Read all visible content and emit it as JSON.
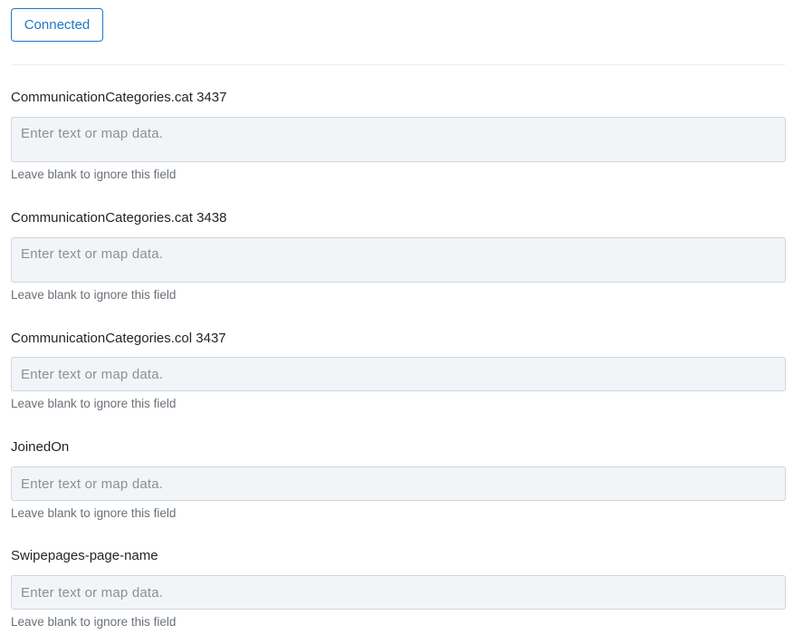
{
  "header": {
    "connected_label": "Connected"
  },
  "fields": [
    {
      "label": "CommunicationCategories.cat 3437",
      "value": "",
      "placeholder": "Enter text or map data.",
      "help": "Leave blank to ignore this field"
    },
    {
      "label": "CommunicationCategories.cat 3438",
      "value": "",
      "placeholder": "Enter text or map data.",
      "help": "Leave blank to ignore this field"
    },
    {
      "label": "CommunicationCategories.col 3437",
      "value": "",
      "placeholder": "Enter text or map data.",
      "help": "Leave blank to ignore this field"
    },
    {
      "label": "JoinedOn",
      "value": "",
      "placeholder": "Enter text or map data.",
      "help": "Leave blank to ignore this field"
    },
    {
      "label": "Swipepages-page-name",
      "value": "",
      "placeholder": "Enter text or map data.",
      "help": "Leave blank to ignore this field"
    }
  ],
  "colors": {
    "accent": "#1f78c8",
    "input_background": "#f2f5f8",
    "input_border": "#cfd6dd",
    "help_text": "#6b7178"
  }
}
